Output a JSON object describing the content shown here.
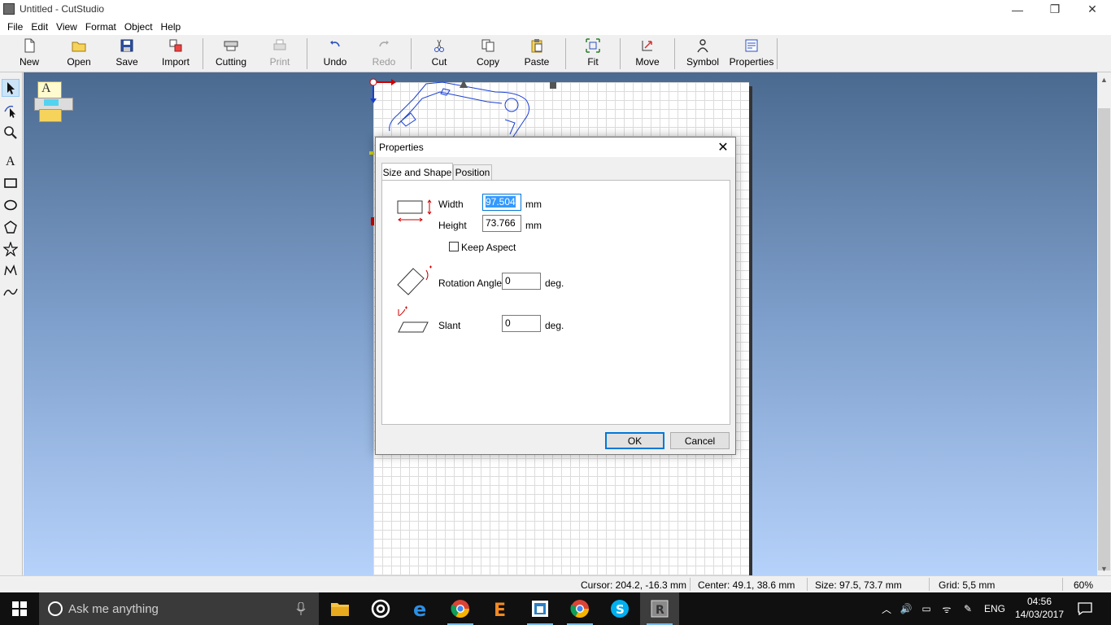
{
  "window": {
    "title": "Untitled - CutStudio",
    "minimize_glyph": "—",
    "restore_glyph": "❐",
    "close_glyph": "✕"
  },
  "menu": [
    "File",
    "Edit",
    "View",
    "Format",
    "Object",
    "Help"
  ],
  "toolbar": {
    "new": "New",
    "open": "Open",
    "save": "Save",
    "import": "Import",
    "cutting": "Cutting",
    "print": "Print",
    "undo": "Undo",
    "redo": "Redo",
    "cut": "Cut",
    "copy": "Copy",
    "paste": "Paste",
    "fit": "Fit",
    "move": "Move",
    "symbol": "Symbol",
    "properties": "Properties"
  },
  "tools": [
    "select-arrow-icon",
    "node-edit-icon",
    "zoom-icon",
    "text-icon",
    "rectangle-icon",
    "ellipse-icon",
    "polygon-icon",
    "star-icon",
    "polyline-icon",
    "curve-icon"
  ],
  "canvas": {
    "thumbnail_letter": "A"
  },
  "dialog": {
    "title": "Properties",
    "close_glyph": "✕",
    "tabs": [
      "Size and Shape",
      "Position"
    ],
    "active_tab": "Size and Shape",
    "width_label": "Width",
    "width_value": "97.504",
    "width_unit": "mm",
    "height_label": "Height",
    "height_value": "73.766",
    "height_unit": "mm",
    "keep_aspect_label": "Keep Aspect",
    "keep_aspect_checked": false,
    "rotation_label": "Rotation Angle",
    "rotation_value": "0",
    "rotation_unit": "deg.",
    "slant_label": "Slant",
    "slant_value": "0",
    "slant_unit": "deg.",
    "ok_label": "OK",
    "cancel_label": "Cancel"
  },
  "status": {
    "cursor": "Cursor: 204.2, -16.3 mm",
    "center": "Center: 49.1, 38.6 mm",
    "size": "Size: 97.5, 73.7 mm",
    "grid": "Grid: 5,5 mm",
    "zoom": "60%"
  },
  "taskbar": {
    "search_placeholder": "Ask me anything",
    "language": "ENG",
    "time": "04:56",
    "date": "14/03/2017",
    "apps": [
      "file-explorer-icon",
      "media-player-icon",
      "edge-icon",
      "chrome-icon",
      "e-app-icon",
      "store-app-icon",
      "chrome-icon",
      "skype-icon",
      "cutstudio-icon"
    ]
  },
  "colors": {
    "accent": "#0078d7",
    "workspace_top": "#4b6a90",
    "workspace_bottom": "#b6d2fb",
    "shape_stroke": "#1a3fd4"
  }
}
